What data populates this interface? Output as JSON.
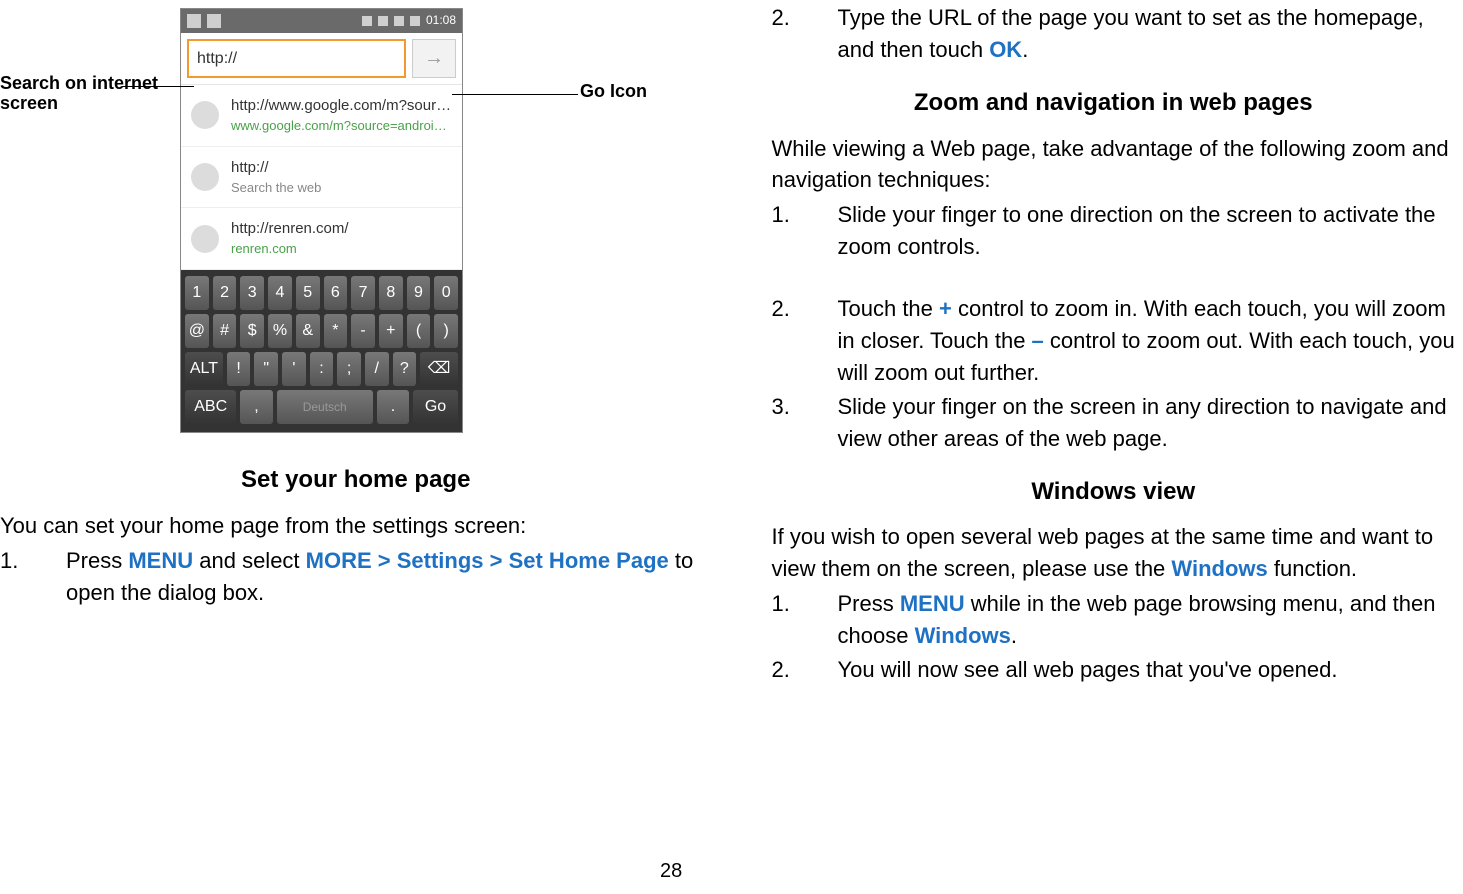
{
  "left": {
    "callout_left": "Search on internet screen",
    "callout_right": "Go Icon",
    "phone": {
      "status": {
        "time": "01:08"
      },
      "url_value": "http://",
      "suggestions": [
        {
          "line1": "http://www.google.com/m?source...",
          "line2": "www.google.com/m?source=android-ho...",
          "green": true
        },
        {
          "line1": "http://",
          "line2": "Search the web",
          "green": false
        },
        {
          "line1": "http://renren.com/",
          "line2": "renren.com",
          "green": true
        }
      ],
      "keys": {
        "row1": [
          "1",
          "2",
          "3",
          "4",
          "5",
          "6",
          "7",
          "8",
          "9",
          "0"
        ],
        "row2": [
          "@",
          "#",
          "$",
          "%",
          "&",
          "*",
          "-",
          "+",
          "(",
          ")"
        ],
        "row3": [
          "ALT",
          "!",
          "\"",
          "'",
          ":",
          ";",
          "/",
          "?",
          "⌫"
        ],
        "row4": [
          "ABC",
          ",",
          "Deutsch",
          ".",
          "Go"
        ]
      }
    },
    "section_title": "Set your home page",
    "intro": "You can set your home page from the settings screen:",
    "item1_a": "Press ",
    "item1_menu": "MENU",
    "item1_b": " and select ",
    "item1_path": "MORE > Settings > Set Home Page",
    "item1_c": " to open the dialog box."
  },
  "right": {
    "top_item2_a": "Type the URL of the page you want to set as the homepage, and then touch ",
    "top_item2_ok": "OK",
    "top_item2_b": ".",
    "zoom_title": "Zoom and navigation in web pages",
    "zoom_intro": "While viewing a Web page, take advantage of the following zoom and navigation techniques:",
    "zoom_item1": "Slide your finger to one direction on the screen to activate the zoom controls.",
    "zoom_item2_a": "Touch the ",
    "zoom_item2_plus": "+",
    "zoom_item2_b": " control to zoom in. With each touch, you will zoom in closer. Touch the ",
    "zoom_item2_minus": "–",
    "zoom_item2_c": " control to zoom out. With each touch, you will zoom out further.",
    "zoom_item3": "Slide your finger on the screen in any direction to navigate and view other areas of the web page.",
    "win_title": "Windows view",
    "win_intro_a": "If you wish to open several web pages at the same time and want to view them on the screen, please use the ",
    "win_intro_w": "Windows",
    "win_intro_b": " function.",
    "win_item1_a": "Press ",
    "win_item1_menu": "MENU",
    "win_item1_b": " while in the web page browsing menu, and then choose ",
    "win_item1_w": "Windows",
    "win_item1_c": ".",
    "win_item2": "You will now see all web pages that you've opened."
  },
  "pagenum": "28"
}
